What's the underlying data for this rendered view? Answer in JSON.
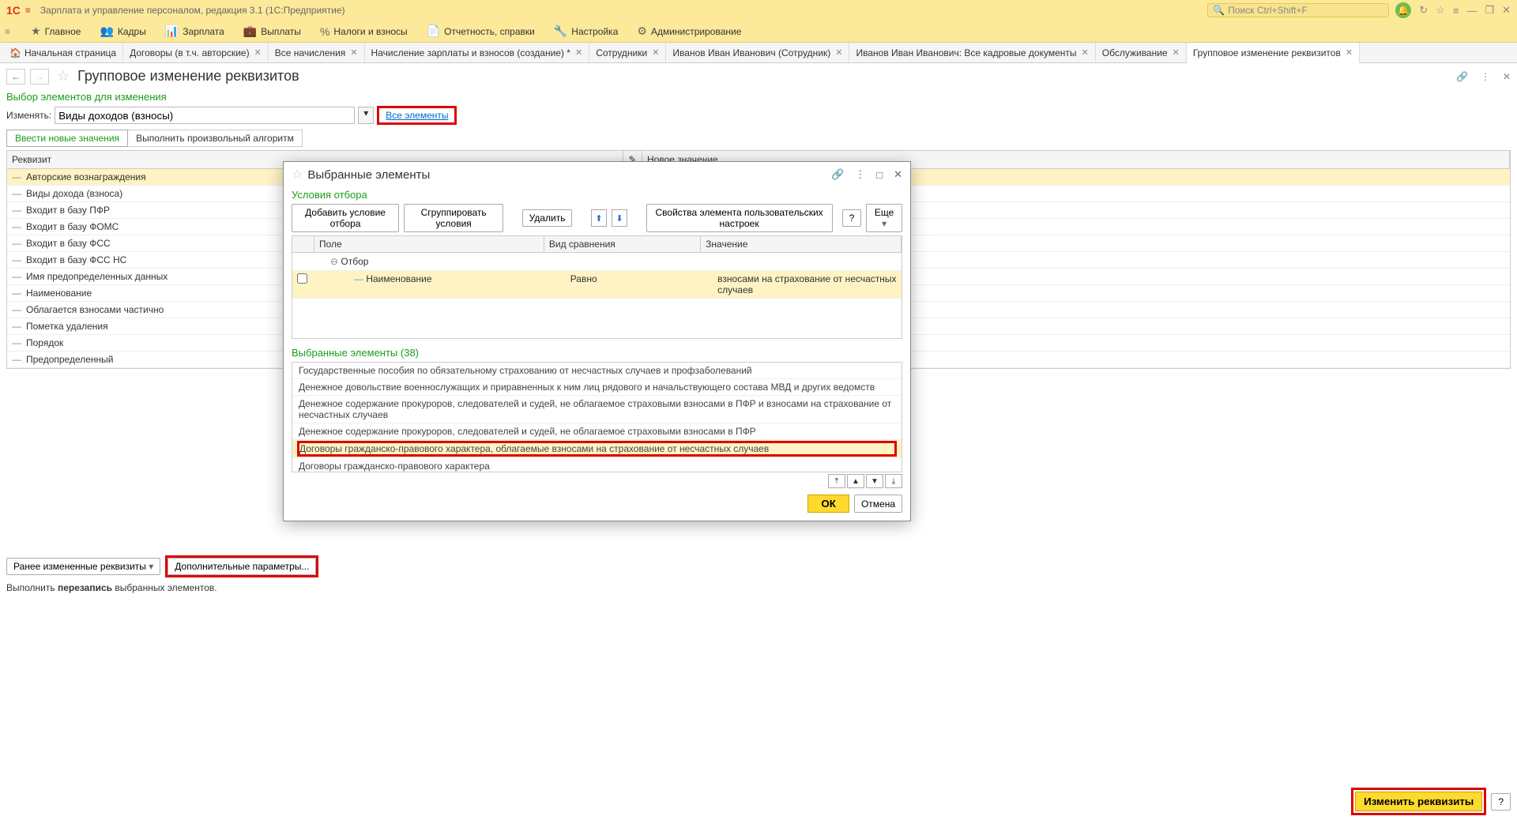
{
  "titlebar": {
    "logo": "1C",
    "app_title": "Зарплата и управление персоналом, редакция 3.1  (1С:Предприятие)",
    "search_placeholder": "Поиск Ctrl+Shift+F"
  },
  "mainmenu": [
    {
      "icon": "★",
      "label": "Главное"
    },
    {
      "icon": "👥",
      "label": "Кадры"
    },
    {
      "icon": "📊",
      "label": "Зарплата"
    },
    {
      "icon": "💼",
      "label": "Выплаты"
    },
    {
      "icon": "%",
      "label": "Налоги и взносы"
    },
    {
      "icon": "📄",
      "label": "Отчетность, справки"
    },
    {
      "icon": "🔧",
      "label": "Настройка"
    },
    {
      "icon": "⚙",
      "label": "Администрирование"
    }
  ],
  "tabs": [
    {
      "label": "Начальная страница",
      "home": true
    },
    {
      "label": "Договоры (в т.ч. авторские)"
    },
    {
      "label": "Все начисления"
    },
    {
      "label": "Начисление зарплаты и взносов (создание) *"
    },
    {
      "label": "Сотрудники"
    },
    {
      "label": "Иванов Иван Иванович (Сотрудник)"
    },
    {
      "label": "Иванов Иван Иванович: Все кадровые документы"
    },
    {
      "label": "Обслуживание"
    },
    {
      "label": "Групповое изменение реквизитов",
      "active": true
    }
  ],
  "page": {
    "title": "Групповое изменение реквизитов",
    "selection_title": "Выбор элементов для изменения",
    "change_label": "Изменять:",
    "change_value": "Виды доходов (взносы)",
    "all_elements_link": "Все элементы",
    "subtabs": {
      "enter": "Ввести новые значения",
      "alg": "Выполнить произвольный алгоритм"
    },
    "grid_headers": {
      "req": "Реквизит",
      "newval": "Новое значение"
    },
    "rows": [
      "Авторские вознаграждения",
      "Виды дохода (взноса)",
      "Входит в базу ПФР",
      "Входит в базу ФОМС",
      "Входит в базу ФСС",
      "Входит в базу ФСС НС",
      "Имя предопределенных данных",
      "Наименование",
      "Облагается взносами частично",
      "Пометка удаления",
      "Порядок",
      "Предопределенный"
    ]
  },
  "bottom": {
    "prev_btn": "Ранее измененные реквизиты",
    "addl_btn": "Дополнительные параметры...",
    "footer1": "Выполнить ",
    "footer2": "перезапись",
    "footer3": " выбранных элементов.",
    "change_btn": "Изменить реквизиты",
    "help": "?"
  },
  "modal": {
    "title": "Выбранные элементы",
    "conditions_title": "Условия отбора",
    "toolbar": {
      "add": "Добавить условие отбора",
      "group": "Сгруппировать условия",
      "delete": "Удалить",
      "props": "Свойства элемента пользовательских настроек",
      "help": "?",
      "more": "Еще"
    },
    "filter_headers": {
      "field": "Поле",
      "cmp": "Вид сравнения",
      "val": "Значение"
    },
    "filter_root": "Отбор",
    "filter_row": {
      "field": "Наименование",
      "cmp": "Равно",
      "val": "взносами на страхование от несчастных случаев"
    },
    "selected_title": "Выбранные элементы (38)",
    "items": [
      "Государственные пособия по обязательному страхованию от несчастных случаев и профзаболеваний",
      "Денежное довольствие военнослужащих и приравненных к ним лиц рядового и начальствующего состава МВД и других ведомств",
      "Денежное содержание прокуроров, следователей и судей, не облагаемое страховыми взносами в ПФР и взносами на страхование от несчастных случаев",
      "Денежное содержание прокуроров, следователей и судей, не облагаемое страховыми взносами в ПФР",
      "Договоры гражданско-правового характера, облагаемые взносами на страхование от несчастных случаев",
      "Договоры гражданско-правового характера"
    ],
    "highlighted_index": 4,
    "ok": "ОК",
    "cancel": "Отмена"
  }
}
